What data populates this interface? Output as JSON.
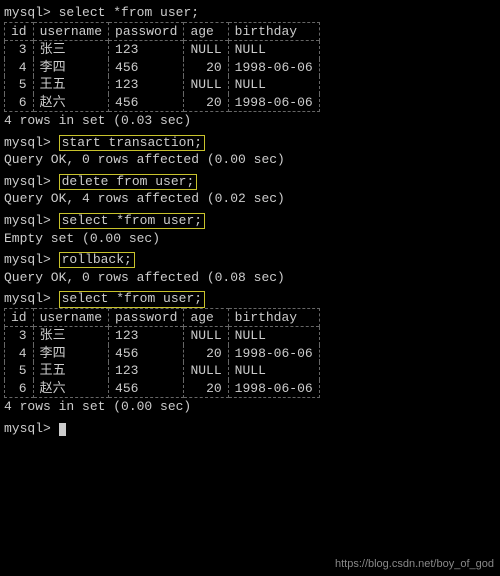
{
  "prompt": "mysql>",
  "cmds": {
    "select1": "select *from user;",
    "start_tx": "start transaction;",
    "delete": "delete from user;",
    "select2": "select *from user;",
    "rollback": "rollback;",
    "select3": "select *from user;"
  },
  "headers": {
    "id": "id",
    "username": "username",
    "password": "password",
    "age": "age",
    "birthday": "birthday"
  },
  "rows": [
    {
      "id": "3",
      "username": "张三",
      "password": "123",
      "age": "NULL",
      "birthday": "NULL"
    },
    {
      "id": "4",
      "username": "李四",
      "password": "456",
      "age": "20",
      "birthday": "1998-06-06"
    },
    {
      "id": "5",
      "username": "王五",
      "password": "123",
      "age": "NULL",
      "birthday": "NULL"
    },
    {
      "id": "6",
      "username": "赵六",
      "password": "456",
      "age": "20",
      "birthday": "1998-06-06"
    }
  ],
  "msgs": {
    "rows_set_1": "4 rows in set (0.03 sec)",
    "ok_0_000": "Query OK, 0 rows affected (0.00 sec)",
    "ok_4_002": "Query OK, 4 rows affected (0.02 sec)",
    "empty": "Empty set (0.00 sec)",
    "ok_0_008": "Query OK, 0 rows affected (0.08 sec)",
    "rows_set_2": "4 rows in set (0.00 sec)"
  },
  "watermark": "https://blog.csdn.net/boy_of_god"
}
